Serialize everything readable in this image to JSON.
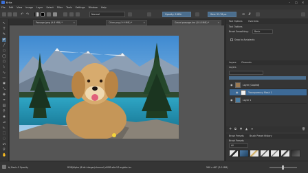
{
  "window": {
    "title": "Krita"
  },
  "menubar": {
    "items": [
      "File",
      "Edit",
      "View",
      "Image",
      "Layer",
      "Select",
      "Filter",
      "Tools",
      "Settings",
      "Window",
      "Help"
    ]
  },
  "toolbar": {
    "blend_mode": "Normal",
    "opacity_label": "Opacity: 100%",
    "size_label": "Size: 31.76 px"
  },
  "document_tabs": [
    {
      "label": "Passage.jpeg (9.8 MiB) *"
    },
    {
      "label": "Chien.png (9.9 MiB) *"
    },
    {
      "label": "Grand passage.kra (10.8 MiB) *"
    }
  ],
  "right_dock": {
    "tool_options_tab": "Tool Options",
    "overview_tab": "Overview",
    "tool_options_title": "Tool Options",
    "brush_smoothing_label": "Brush Smoothing:",
    "brush_smoothing_value": "Basic",
    "snap_label": "Snap to Assistants",
    "layers_tab": "Layers",
    "channels_tab": "Channels",
    "layers_header": "Layers",
    "layers": [
      {
        "name": "Layer (Copied)",
        "selected": false,
        "thumb_color": "#9c7a52"
      },
      {
        "name": "Transparency Mask 1",
        "selected": true,
        "thumb_color": "#f2f2f2"
      },
      {
        "name": "Layer 1",
        "selected": false,
        "thumb_color": "#4a7fa5"
      }
    ],
    "brush_presets_tab": "Brush Presets",
    "brush_history_tab": "Brush Preset History",
    "brush_presets_header": "Brush Presets",
    "brush_tag": "All"
  },
  "status": {
    "left": "b) Basic-5 Opacity",
    "center": "RGB/Alpha (8-bit integer/channel)  sRGB-elle-V2-srgbtrc.icc",
    "right": "560 x 467 (3.0 MiB)"
  },
  "colors": {
    "accent": "#4b6e8e",
    "selected_layer": "#3d6a97",
    "fg_color": "#000000",
    "bg_color": "#ffffff"
  }
}
